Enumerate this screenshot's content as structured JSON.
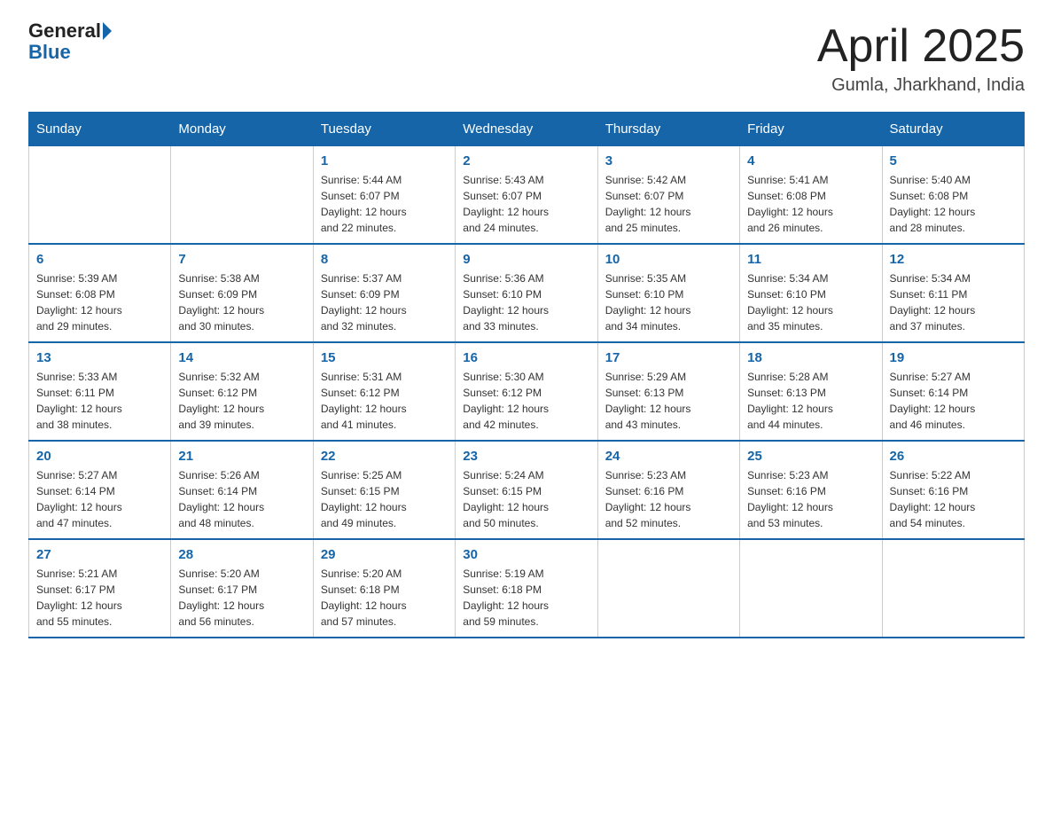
{
  "header": {
    "logo_general": "General",
    "logo_blue": "Blue",
    "month_title": "April 2025",
    "location": "Gumla, Jharkhand, India"
  },
  "days_of_week": [
    "Sunday",
    "Monday",
    "Tuesday",
    "Wednesday",
    "Thursday",
    "Friday",
    "Saturday"
  ],
  "weeks": [
    [
      {
        "num": "",
        "info": ""
      },
      {
        "num": "",
        "info": ""
      },
      {
        "num": "1",
        "info": "Sunrise: 5:44 AM\nSunset: 6:07 PM\nDaylight: 12 hours\nand 22 minutes."
      },
      {
        "num": "2",
        "info": "Sunrise: 5:43 AM\nSunset: 6:07 PM\nDaylight: 12 hours\nand 24 minutes."
      },
      {
        "num": "3",
        "info": "Sunrise: 5:42 AM\nSunset: 6:07 PM\nDaylight: 12 hours\nand 25 minutes."
      },
      {
        "num": "4",
        "info": "Sunrise: 5:41 AM\nSunset: 6:08 PM\nDaylight: 12 hours\nand 26 minutes."
      },
      {
        "num": "5",
        "info": "Sunrise: 5:40 AM\nSunset: 6:08 PM\nDaylight: 12 hours\nand 28 minutes."
      }
    ],
    [
      {
        "num": "6",
        "info": "Sunrise: 5:39 AM\nSunset: 6:08 PM\nDaylight: 12 hours\nand 29 minutes."
      },
      {
        "num": "7",
        "info": "Sunrise: 5:38 AM\nSunset: 6:09 PM\nDaylight: 12 hours\nand 30 minutes."
      },
      {
        "num": "8",
        "info": "Sunrise: 5:37 AM\nSunset: 6:09 PM\nDaylight: 12 hours\nand 32 minutes."
      },
      {
        "num": "9",
        "info": "Sunrise: 5:36 AM\nSunset: 6:10 PM\nDaylight: 12 hours\nand 33 minutes."
      },
      {
        "num": "10",
        "info": "Sunrise: 5:35 AM\nSunset: 6:10 PM\nDaylight: 12 hours\nand 34 minutes."
      },
      {
        "num": "11",
        "info": "Sunrise: 5:34 AM\nSunset: 6:10 PM\nDaylight: 12 hours\nand 35 minutes."
      },
      {
        "num": "12",
        "info": "Sunrise: 5:34 AM\nSunset: 6:11 PM\nDaylight: 12 hours\nand 37 minutes."
      }
    ],
    [
      {
        "num": "13",
        "info": "Sunrise: 5:33 AM\nSunset: 6:11 PM\nDaylight: 12 hours\nand 38 minutes."
      },
      {
        "num": "14",
        "info": "Sunrise: 5:32 AM\nSunset: 6:12 PM\nDaylight: 12 hours\nand 39 minutes."
      },
      {
        "num": "15",
        "info": "Sunrise: 5:31 AM\nSunset: 6:12 PM\nDaylight: 12 hours\nand 41 minutes."
      },
      {
        "num": "16",
        "info": "Sunrise: 5:30 AM\nSunset: 6:12 PM\nDaylight: 12 hours\nand 42 minutes."
      },
      {
        "num": "17",
        "info": "Sunrise: 5:29 AM\nSunset: 6:13 PM\nDaylight: 12 hours\nand 43 minutes."
      },
      {
        "num": "18",
        "info": "Sunrise: 5:28 AM\nSunset: 6:13 PM\nDaylight: 12 hours\nand 44 minutes."
      },
      {
        "num": "19",
        "info": "Sunrise: 5:27 AM\nSunset: 6:14 PM\nDaylight: 12 hours\nand 46 minutes."
      }
    ],
    [
      {
        "num": "20",
        "info": "Sunrise: 5:27 AM\nSunset: 6:14 PM\nDaylight: 12 hours\nand 47 minutes."
      },
      {
        "num": "21",
        "info": "Sunrise: 5:26 AM\nSunset: 6:14 PM\nDaylight: 12 hours\nand 48 minutes."
      },
      {
        "num": "22",
        "info": "Sunrise: 5:25 AM\nSunset: 6:15 PM\nDaylight: 12 hours\nand 49 minutes."
      },
      {
        "num": "23",
        "info": "Sunrise: 5:24 AM\nSunset: 6:15 PM\nDaylight: 12 hours\nand 50 minutes."
      },
      {
        "num": "24",
        "info": "Sunrise: 5:23 AM\nSunset: 6:16 PM\nDaylight: 12 hours\nand 52 minutes."
      },
      {
        "num": "25",
        "info": "Sunrise: 5:23 AM\nSunset: 6:16 PM\nDaylight: 12 hours\nand 53 minutes."
      },
      {
        "num": "26",
        "info": "Sunrise: 5:22 AM\nSunset: 6:16 PM\nDaylight: 12 hours\nand 54 minutes."
      }
    ],
    [
      {
        "num": "27",
        "info": "Sunrise: 5:21 AM\nSunset: 6:17 PM\nDaylight: 12 hours\nand 55 minutes."
      },
      {
        "num": "28",
        "info": "Sunrise: 5:20 AM\nSunset: 6:17 PM\nDaylight: 12 hours\nand 56 minutes."
      },
      {
        "num": "29",
        "info": "Sunrise: 5:20 AM\nSunset: 6:18 PM\nDaylight: 12 hours\nand 57 minutes."
      },
      {
        "num": "30",
        "info": "Sunrise: 5:19 AM\nSunset: 6:18 PM\nDaylight: 12 hours\nand 59 minutes."
      },
      {
        "num": "",
        "info": ""
      },
      {
        "num": "",
        "info": ""
      },
      {
        "num": "",
        "info": ""
      }
    ]
  ]
}
